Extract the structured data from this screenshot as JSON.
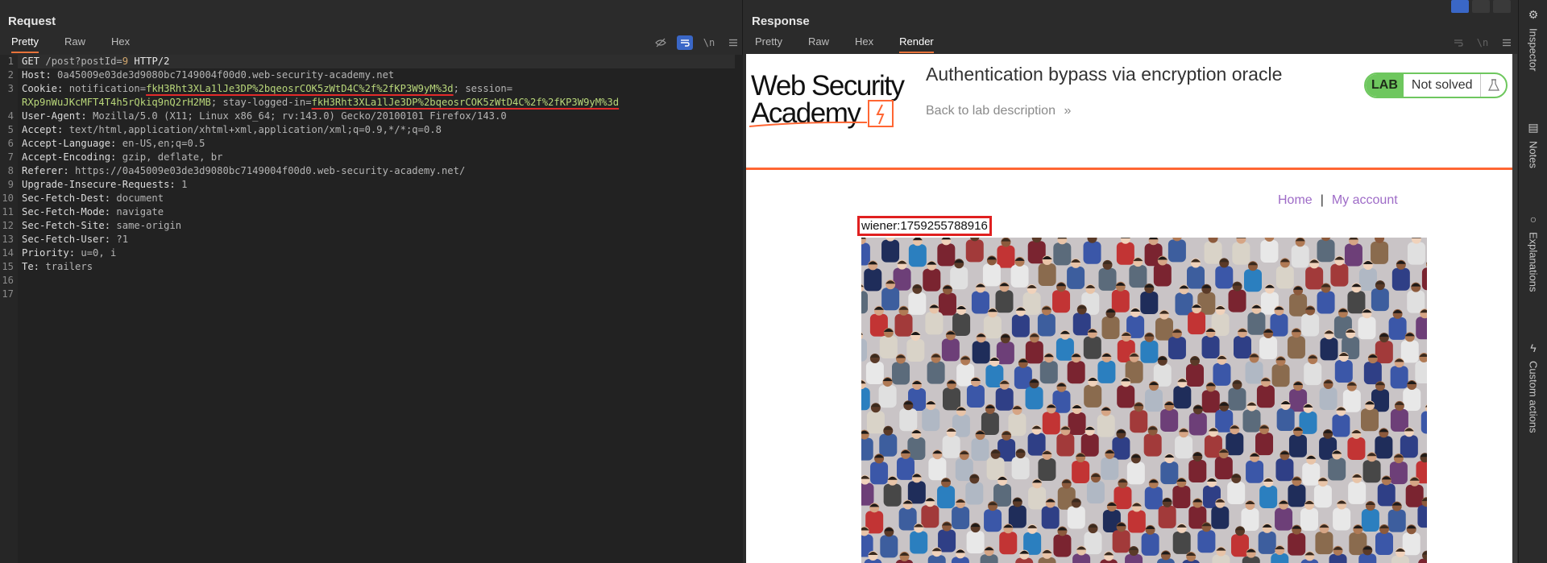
{
  "request": {
    "title": "Request",
    "tabs": [
      "Pretty",
      "Raw",
      "Hex"
    ],
    "active_tab": "Pretty",
    "tools": {
      "hide_icon": "eye-off-icon",
      "wrap_icon": "wrap-icon",
      "newline": "\\n",
      "menu_icon": "menu-icon"
    },
    "lines": [
      {
        "n": "1",
        "parts": [
          [
            "kw",
            "GET "
          ],
          [
            "val",
            "/post?postId="
          ],
          [
            "num",
            "9"
          ],
          [
            "kw",
            " HTTP/2"
          ]
        ]
      },
      {
        "n": "2",
        "parts": [
          [
            "key",
            "Host: "
          ],
          [
            "val",
            "0a45009e03de3d9080bc7149004f00d0.web-security-academy.net"
          ]
        ]
      },
      {
        "n": "3",
        "parts": [
          [
            "key",
            "Cookie: "
          ],
          [
            "val",
            "notification="
          ],
          [
            "ck ul",
            "fkH3Rht3XLa1lJe3DP%2bqeosrCOK5zWtD4C%2f%2fKP3W9yM%3d"
          ],
          [
            "val",
            "; session="
          ]
        ]
      },
      {
        "n": "",
        "parts": [
          [
            "ck",
            "RXp9nWuJKcMFT4T4h5rQkiq9nQ2rH2MB"
          ],
          [
            "val",
            "; stay-logged-in="
          ],
          [
            "ck ul",
            "fkH3Rht3XLa1lJe3DP%2bqeosrCOK5zWtD4C%2f%2fKP3W9yM%3d"
          ]
        ]
      },
      {
        "n": "4",
        "parts": [
          [
            "key",
            "User-Agent: "
          ],
          [
            "val",
            "Mozilla/5.0 (X11; Linux x86_64; rv:143.0) Gecko/20100101 Firefox/143.0"
          ]
        ]
      },
      {
        "n": "5",
        "parts": [
          [
            "key",
            "Accept: "
          ],
          [
            "val",
            "text/html,application/xhtml+xml,application/xml;q=0.9,*/*;q=0.8"
          ]
        ]
      },
      {
        "n": "6",
        "parts": [
          [
            "key",
            "Accept-Language: "
          ],
          [
            "val",
            "en-US,en;q=0.5"
          ]
        ]
      },
      {
        "n": "7",
        "parts": [
          [
            "key",
            "Accept-Encoding: "
          ],
          [
            "val",
            "gzip, deflate, br"
          ]
        ]
      },
      {
        "n": "8",
        "parts": [
          [
            "key",
            "Referer: "
          ],
          [
            "val",
            "https://0a45009e03de3d9080bc7149004f00d0.web-security-academy.net/"
          ]
        ]
      },
      {
        "n": "9",
        "parts": [
          [
            "key",
            "Upgrade-Insecure-Requests: "
          ],
          [
            "val",
            "1"
          ]
        ]
      },
      {
        "n": "10",
        "parts": [
          [
            "key",
            "Sec-Fetch-Dest: "
          ],
          [
            "val",
            "document"
          ]
        ]
      },
      {
        "n": "11",
        "parts": [
          [
            "key",
            "Sec-Fetch-Mode: "
          ],
          [
            "val",
            "navigate"
          ]
        ]
      },
      {
        "n": "12",
        "parts": [
          [
            "key",
            "Sec-Fetch-Site: "
          ],
          [
            "val",
            "same-origin"
          ]
        ]
      },
      {
        "n": "13",
        "parts": [
          [
            "key",
            "Sec-Fetch-User: "
          ],
          [
            "val",
            "?1"
          ]
        ]
      },
      {
        "n": "14",
        "parts": [
          [
            "key",
            "Priority: "
          ],
          [
            "val",
            "u=0, i"
          ]
        ]
      },
      {
        "n": "15",
        "parts": [
          [
            "key",
            "Te: "
          ],
          [
            "val",
            "trailers"
          ]
        ]
      },
      {
        "n": "16",
        "parts": []
      },
      {
        "n": "17",
        "parts": []
      }
    ]
  },
  "response": {
    "title": "Response",
    "tabs": [
      "Pretty",
      "Raw",
      "Hex",
      "Render"
    ],
    "active_tab": "Render",
    "page": {
      "logo_line1": "Web Security",
      "logo_line2": "Academy",
      "lab_title": "Authentication bypass via encryption oracle",
      "back_link": "Back to lab description",
      "back_icon": "»",
      "badge_lab": "LAB",
      "badge_status": "Not solved",
      "flask_icon": "flask-icon",
      "nav_home": "Home",
      "nav_sep": "|",
      "nav_account": "My account",
      "user_text": "wiener:1759255788916",
      "image_icon": "crowd-image"
    }
  },
  "sidebar": {
    "items": [
      {
        "label": "Inspector",
        "icon": "inspector-icon"
      },
      {
        "label": "Notes",
        "icon": "notes-icon"
      },
      {
        "label": "Explanations",
        "icon": "lightbulb-icon"
      },
      {
        "label": "Custom actions",
        "icon": "lightning-icon"
      }
    ]
  },
  "colors": {
    "accent": "#e8733a",
    "tool_on": "#3a67c7",
    "cookie_value": "#b9d77a",
    "underline": "#e22a2a",
    "lab_green": "#6ec75e",
    "wsa_orange": "#ff6633",
    "nav_purple": "#9e6bc7"
  }
}
